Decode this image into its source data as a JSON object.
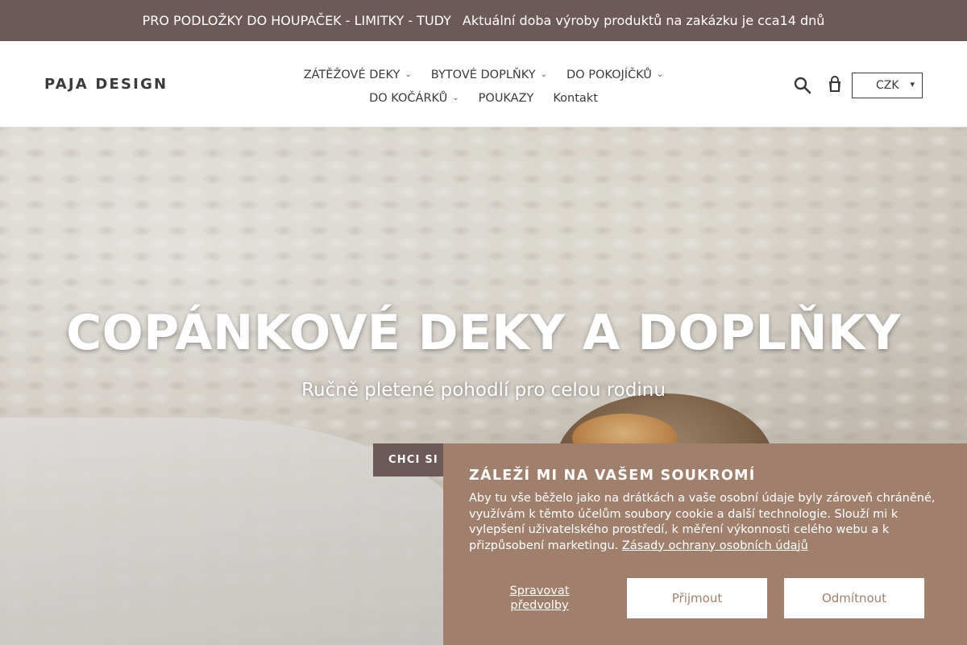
{
  "announcement": {
    "text_1": "PRO PODLOŽKY DO HOUPAČEK - LIMITKY - TUDY",
    "text_2": "Aktuální doba výroby produktů na zakázku je cca14 dnů"
  },
  "header": {
    "logo": "PAJA DESIGN",
    "nav": [
      {
        "label": "ZÁTĚŽOVÉ DEKY",
        "dropdown": true
      },
      {
        "label": "BYTOVÉ DOPLŇKY",
        "dropdown": true
      },
      {
        "label": "DO POKOJÍČKŮ",
        "dropdown": true
      },
      {
        "label": "DO KOČÁRKŮ",
        "dropdown": true
      },
      {
        "label": "POUKAZY",
        "dropdown": false
      },
      {
        "label": "Kontakt",
        "dropdown": false
      }
    ],
    "currency": "CZK"
  },
  "hero": {
    "title": "COPÁNKOVÉ DEKY A DOPLŇKY",
    "subtitle": "Ručně pletené pohodlí pro celou rodinu",
    "cta_label": "CHCI SI PROHLÉDNOUT"
  },
  "cookie_banner": {
    "title": "ZÁLEŽÍ MI NA VAŠEM SOUKROMÍ",
    "text": "Aby tu vše běželo jako na drátkách a vaše osobní údaje byly zároveň chráněné, využívám k těmto účelům soubory cookie a další technologie. Slouží mi k vylepšení uživatelského prostředí, k měření výkonnosti celého webu a k přizpůsobení marketingu.",
    "policy_link": "Zásady ochrany osobních údajů",
    "manage_label": "Spravovat předvolby",
    "accept_label": "Přijmout",
    "decline_label": "Odmítnout"
  },
  "colors": {
    "announcement_bg": "#6d5a58",
    "cta_bg": "#6d5a58",
    "cookie_bg": "#a0806d"
  },
  "icons": [
    "search-icon",
    "cart-icon",
    "chevron-down-icon"
  ]
}
